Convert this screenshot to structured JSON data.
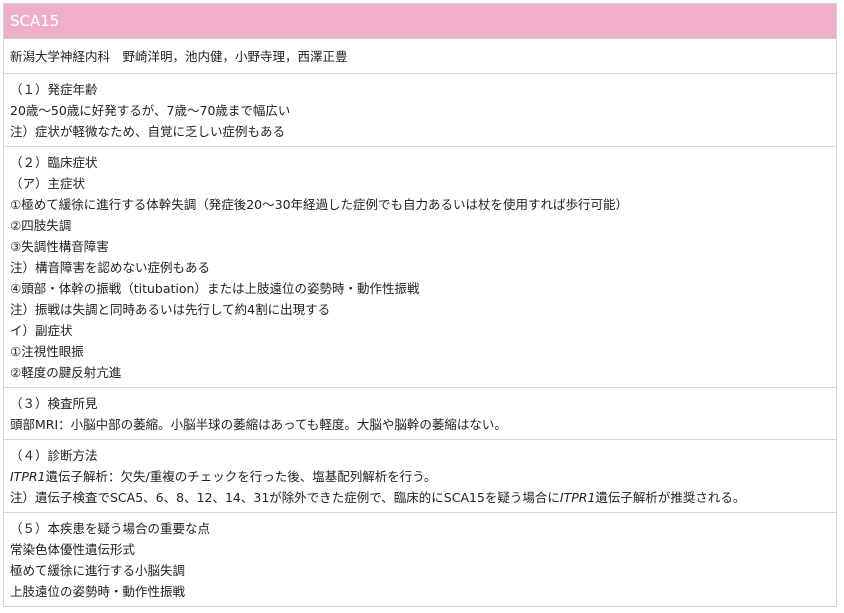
{
  "header": {
    "title": "SCA15",
    "bg_color": "#efaec9"
  },
  "authors": "新潟大学神経内科　野崎洋明，池内健，小野寺理，西澤正豊",
  "sections": [
    {
      "id": "onset",
      "lines": [
        "（１）発症年齢",
        "20歳～50歳に好発するが、7歳～70歳まで幅広い",
        "注）症状が軽微なため、自覚に乏しい症例もある"
      ]
    },
    {
      "id": "symptoms",
      "lines": [
        "（２）臨床症状",
        "（ア）主症状",
        "①極めて緩徐に進行する体幹失調（発症後20～30年経過した症例でも自力あるいは杖を使用すれば歩行可能）",
        "②四肢失調",
        "③失調性構音障害",
        "注）構音障害を認めない症例もある",
        "④頭部・体幹の振戦（titubation）または上肢遠位の姿勢時・動作性振戦",
        "注）振戦は失調と同時あるいは先行して約4割に出現する",
        "イ）副症状",
        "①注視性眼振",
        "②軽度の腱反射亢進"
      ]
    },
    {
      "id": "findings",
      "lines": [
        "（３）検査所見",
        "頭部MRI：小脳中部の萎縮。小脳半球の萎縮はあっても軽度。大脳や脳幹の萎縮はない。"
      ]
    },
    {
      "id": "diagnosis",
      "heading": "（４）診断方法",
      "line2": {
        "gene": "ITPR1",
        "text": "遺伝子解析：欠失/重複のチェックを行った後、塩基配列解析を行う。"
      },
      "line3": {
        "before": "注）遺伝子検査でSCA5、6、8、12、14、31が除外できた症例で、臨床的にSCA15を疑う場合に",
        "gene": "ITPR1",
        "after": "遺伝子解析が推奨される。"
      }
    },
    {
      "id": "key-points",
      "lines": [
        "（５）本疾患を疑う場合の重要な点",
        "常染色体優性遺伝形式",
        "極めて緩徐に進行する小脳失調",
        "上肢遠位の姿勢時・動作性振戦"
      ]
    }
  ]
}
